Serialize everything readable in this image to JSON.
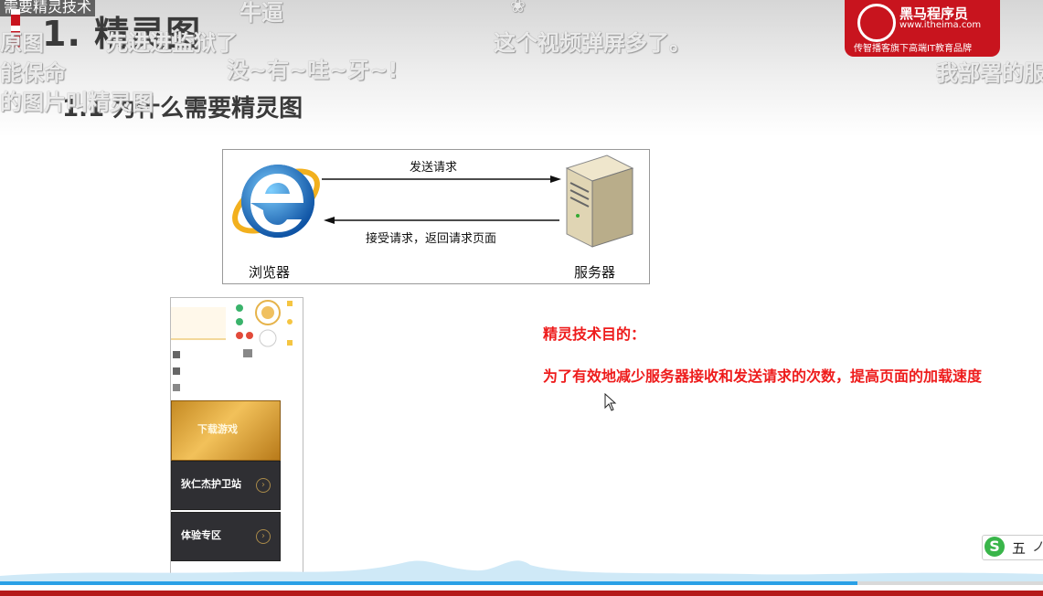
{
  "slide": {
    "title": "1. 精灵图",
    "subtitle": "1.1 为什么需要精灵图",
    "top_caption": "需要精灵技术"
  },
  "danmaku": [
    {
      "text": "牛逼"
    },
    {
      "text": "❀"
    },
    {
      "text": "这个视频弹屏多了。"
    },
    {
      "text": "没~有~哇~牙~!"
    },
    {
      "text": "我部署的服"
    },
    {
      "text": "能保命"
    },
    {
      "text": "的图片叫精灵图"
    },
    {
      "text": "先进进监狱了"
    },
    {
      "text": "原图"
    }
  ],
  "logo": {
    "brand": "黑马程序员",
    "url": "www.itheima.com",
    "slogan": "传智播客旗下高端IT教育品牌"
  },
  "diagram": {
    "request_label": "发送请求",
    "response_label": "接受请求，返回请求页面",
    "browser_label": "浏览器",
    "server_label": "服务器"
  },
  "phone": {
    "download_label": "下载游戏",
    "card1_label": "狄仁杰护卫站",
    "card2_label": "体验专区"
  },
  "goal": {
    "title": "精灵技术目的：",
    "text": "为了有效地减少服务器接收和发送请求的次数，提高页面的加载速度"
  },
  "ime": {
    "logo": "S",
    "mode": "五",
    "extra": "ノ"
  },
  "colors": {
    "accent_red": "#ee1c1c",
    "brand_red": "#c8141e",
    "progress_blue": "#2aa0e6"
  },
  "player": {
    "progress": 0.822
  }
}
